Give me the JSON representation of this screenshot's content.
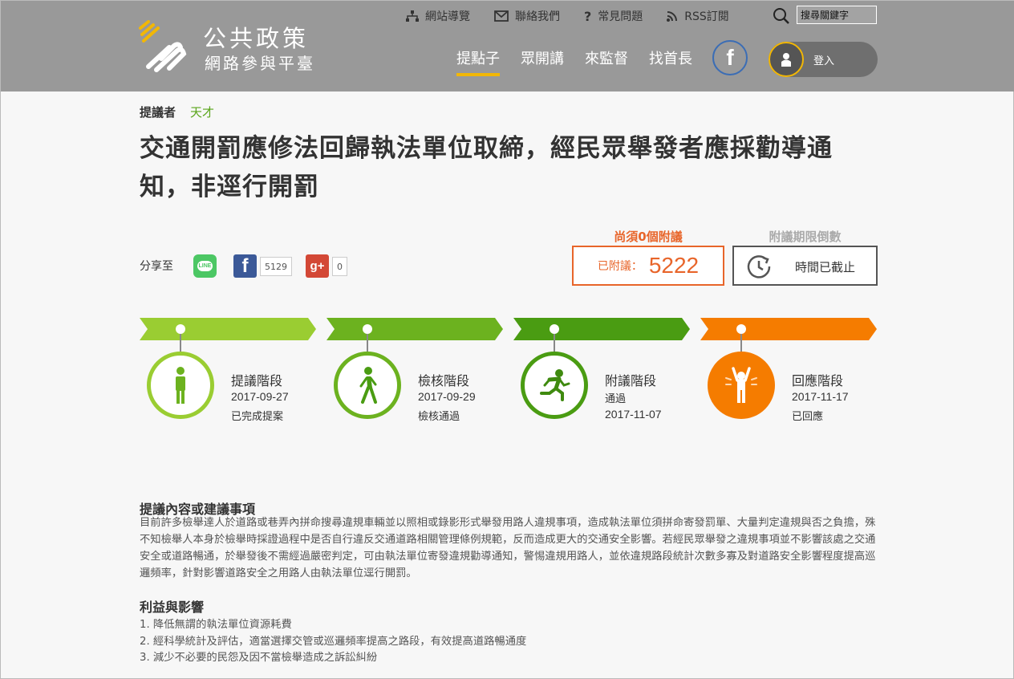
{
  "header": {
    "logo_title": "公共政策",
    "logo_subtitle": "網路參與平臺",
    "top_links": [
      {
        "label": "網站導覽",
        "icon": "sitemap-icon"
      },
      {
        "label": "聯絡我們",
        "icon": "mail-icon"
      },
      {
        "label": "常見問題",
        "icon": "question-icon"
      },
      {
        "label": "RSS訂閱",
        "icon": "rss-icon"
      }
    ],
    "search_placeholder": "搜尋關鍵字",
    "nav": [
      {
        "label": "提點子",
        "active": true
      },
      {
        "label": "眾開講",
        "active": false
      },
      {
        "label": "來監督",
        "active": false
      },
      {
        "label": "找首長",
        "active": false
      }
    ],
    "facebook_glyph": "f",
    "login_label": "登入",
    "colors": {
      "background": "#999999",
      "accent": "#f2b705"
    }
  },
  "proposal": {
    "proposer_label": "提議者",
    "proposer_name": "天才",
    "title": "交通開罰應修法回歸執法單位取締，經民眾舉發者應採勸導通知，非逕行開罰"
  },
  "share": {
    "label": "分享至",
    "line_label": "LINE",
    "facebook_glyph": "f",
    "facebook_count": "5129",
    "gplus_glyph": "g+",
    "gplus_count": "0"
  },
  "status": {
    "need_label": "尚須0個附議",
    "vote_label": "已附議：",
    "vote_count": "5222",
    "countdown_label": "附議期限倒數",
    "countdown_text": "時間已截止",
    "colors": {
      "vote": "#e8652a",
      "countdown": "#555555"
    }
  },
  "stages": [
    {
      "name": "提議階段",
      "line1": "2017-09-27",
      "line2": "已完成提案",
      "icon": "standing-person-icon",
      "color": "#9acd32"
    },
    {
      "name": "檢核階段",
      "line1": "2017-09-29",
      "line2": "檢核通過",
      "icon": "walking-person-icon",
      "color": "#6cb21f"
    },
    {
      "name": "附議階段",
      "line1": "通過",
      "line2": "2017-11-07",
      "icon": "running-person-icon",
      "color": "#4a9c12"
    },
    {
      "name": "回應階段",
      "line1": "2017-11-17",
      "line2": "已回應",
      "icon": "cheering-person-icon",
      "color": "#f57c00"
    }
  ],
  "content": {
    "section1_title": "提議內容或建議事項",
    "section1_body": "目前許多檢舉達人於道路或巷弄內拼命搜尋違規車輛並以照相或錄影形式舉發用路人違規事項，造成執法單位須拼命寄發罰單、大量判定違規與否之負擔，殊不知檢舉人本身於檢舉時採證過程中是否自行違反交通道路相關管理條例規範，反而造成更大的交通安全影響。若經民眾舉發之違規事項並不影響該處之交通安全或道路暢通，於舉發後不需經過嚴密判定，可由執法單位寄發違規勸導通知，警惕違規用路人，並依違規路段統計次數多寡及對道路安全影響程度提高巡邏頻率，針對影響道路安全之用路人由執法單位逕行開罰。",
    "section2_title": "利益與影響",
    "benefits": [
      "1. 降低無謂的執法單位資源耗費",
      "2. 經科學統計及評估，適當選擇交管或巡邏頻率提高之路段，有效提高道路暢通度",
      "3. 減少不必要的民怨及因不當檢舉造成之訴訟糾紛"
    ]
  }
}
